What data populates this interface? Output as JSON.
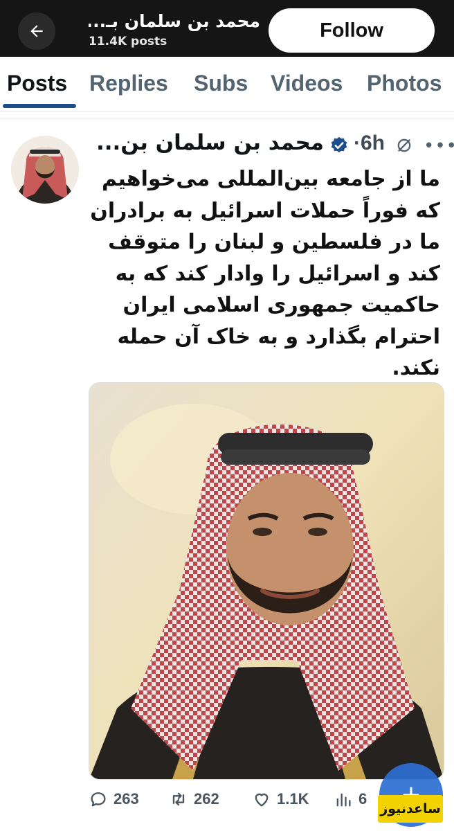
{
  "header": {
    "profile_name": "محمد بن سلمان بـ...",
    "post_count": "11.4K posts",
    "follow_label": "Follow"
  },
  "tabs": [
    {
      "label": "Posts",
      "active": true
    },
    {
      "label": "Replies"
    },
    {
      "label": "Subs"
    },
    {
      "label": "Videos"
    },
    {
      "label": "Photos"
    }
  ],
  "post": {
    "author": "محمد بن سلمان بن...",
    "time": "·6h",
    "text_lines": [
      "ما از جامعه بین‌المللی می‌خواهیم",
      "که فوراً حملات اسرائیل به برادران",
      "ما در فلسطین و لبنان را متوقف",
      "کند و اسرائیل را وادار کند که به",
      "حاکمیت جمهوری اسلامی ایران",
      "احترام بگذارد و به خاک آن حمله",
      "نکند."
    ],
    "actions": {
      "replies": "263",
      "reposts": "262",
      "likes": "1.1K",
      "views": "6"
    }
  },
  "watermark": "ساعدنیوز",
  "colors": {
    "header_bg": "#151515",
    "tab_underline": "#1d4e89",
    "verified": "#1d4e89",
    "fab": "#2d6fd2",
    "watermark_bg": "#f2d200"
  }
}
